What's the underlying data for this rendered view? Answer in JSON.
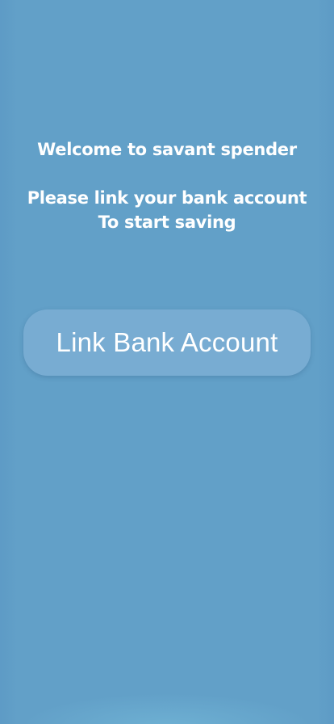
{
  "welcome": {
    "line1": "Welcome to savant spender",
    "line2": "Please link your bank account",
    "line3": "To start saving"
  },
  "actions": {
    "link_bank_label": "Link Bank Account"
  },
  "colors": {
    "background": "#62a0c8",
    "button": "#78acd2",
    "text": "#ffffff"
  }
}
